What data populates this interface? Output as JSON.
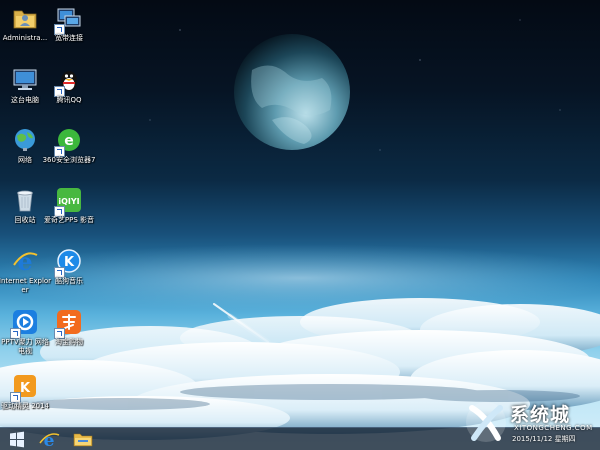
{
  "desktop": {
    "icons": [
      {
        "label": "Administra..."
      },
      {
        "label": "宽带连接"
      },
      {
        "label": "这台电脑"
      },
      {
        "label": "腾讯QQ"
      },
      {
        "label": "网络"
      },
      {
        "label": "360安全浏览器7"
      },
      {
        "label": "回收站"
      },
      {
        "label": "爱奇艺PPS 影音"
      },
      {
        "label": "Internet Explorer"
      },
      {
        "label": "酷狗音乐"
      },
      {
        "label": "PPTV聚力 网络电视"
      },
      {
        "label": "淘宝购物"
      },
      {
        "label": "驱动精灵 2014"
      }
    ]
  },
  "taskbar": {
    "start_icon": "windows-logo-icon",
    "pinned": [
      "internet-explorer-icon",
      "file-explorer-icon"
    ]
  },
  "watermark": {
    "brand": "系统城",
    "site": "XITONGCHENG.COM",
    "date": "2015/11/12 星期四"
  }
}
